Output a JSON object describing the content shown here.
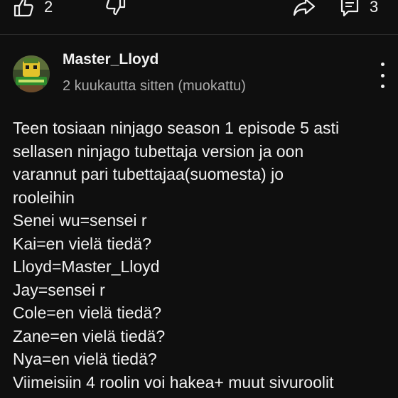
{
  "actions": {
    "like_count": "2",
    "comment_count": "3"
  },
  "comment": {
    "author": "Master_Lloyd",
    "meta": "2 kuukautta sitten (muokattu)",
    "lines": [
      "Teen tosiaan ninjago season 1 episode 5 asti",
      "sellasen ninjago tubettaja version ja oon",
      "varannut pari tubettajaa(suomesta) jo",
      "rooleihin",
      "Senei wu=sensei r",
      "Kai=en vielä tiedä?",
      "Lloyd=Master_Lloyd",
      "Jay=sensei r",
      "Cole=en vielä tiedä?",
      "Zane=en vielä tiedä?",
      "Nya=en vielä tiedä?",
      "Viimeisiin 4 roolin voi hakea+ muut sivuroolit"
    ]
  },
  "icons": {
    "like": "thumb-up-icon",
    "dislike": "thumb-down-icon",
    "share": "share-icon",
    "comments": "comment-icon",
    "menu": "more-vertical-icon"
  },
  "colors": {
    "background": "#0f0f0f",
    "text": "#f1f1f1",
    "secondary_text": "#aaaaaa"
  }
}
